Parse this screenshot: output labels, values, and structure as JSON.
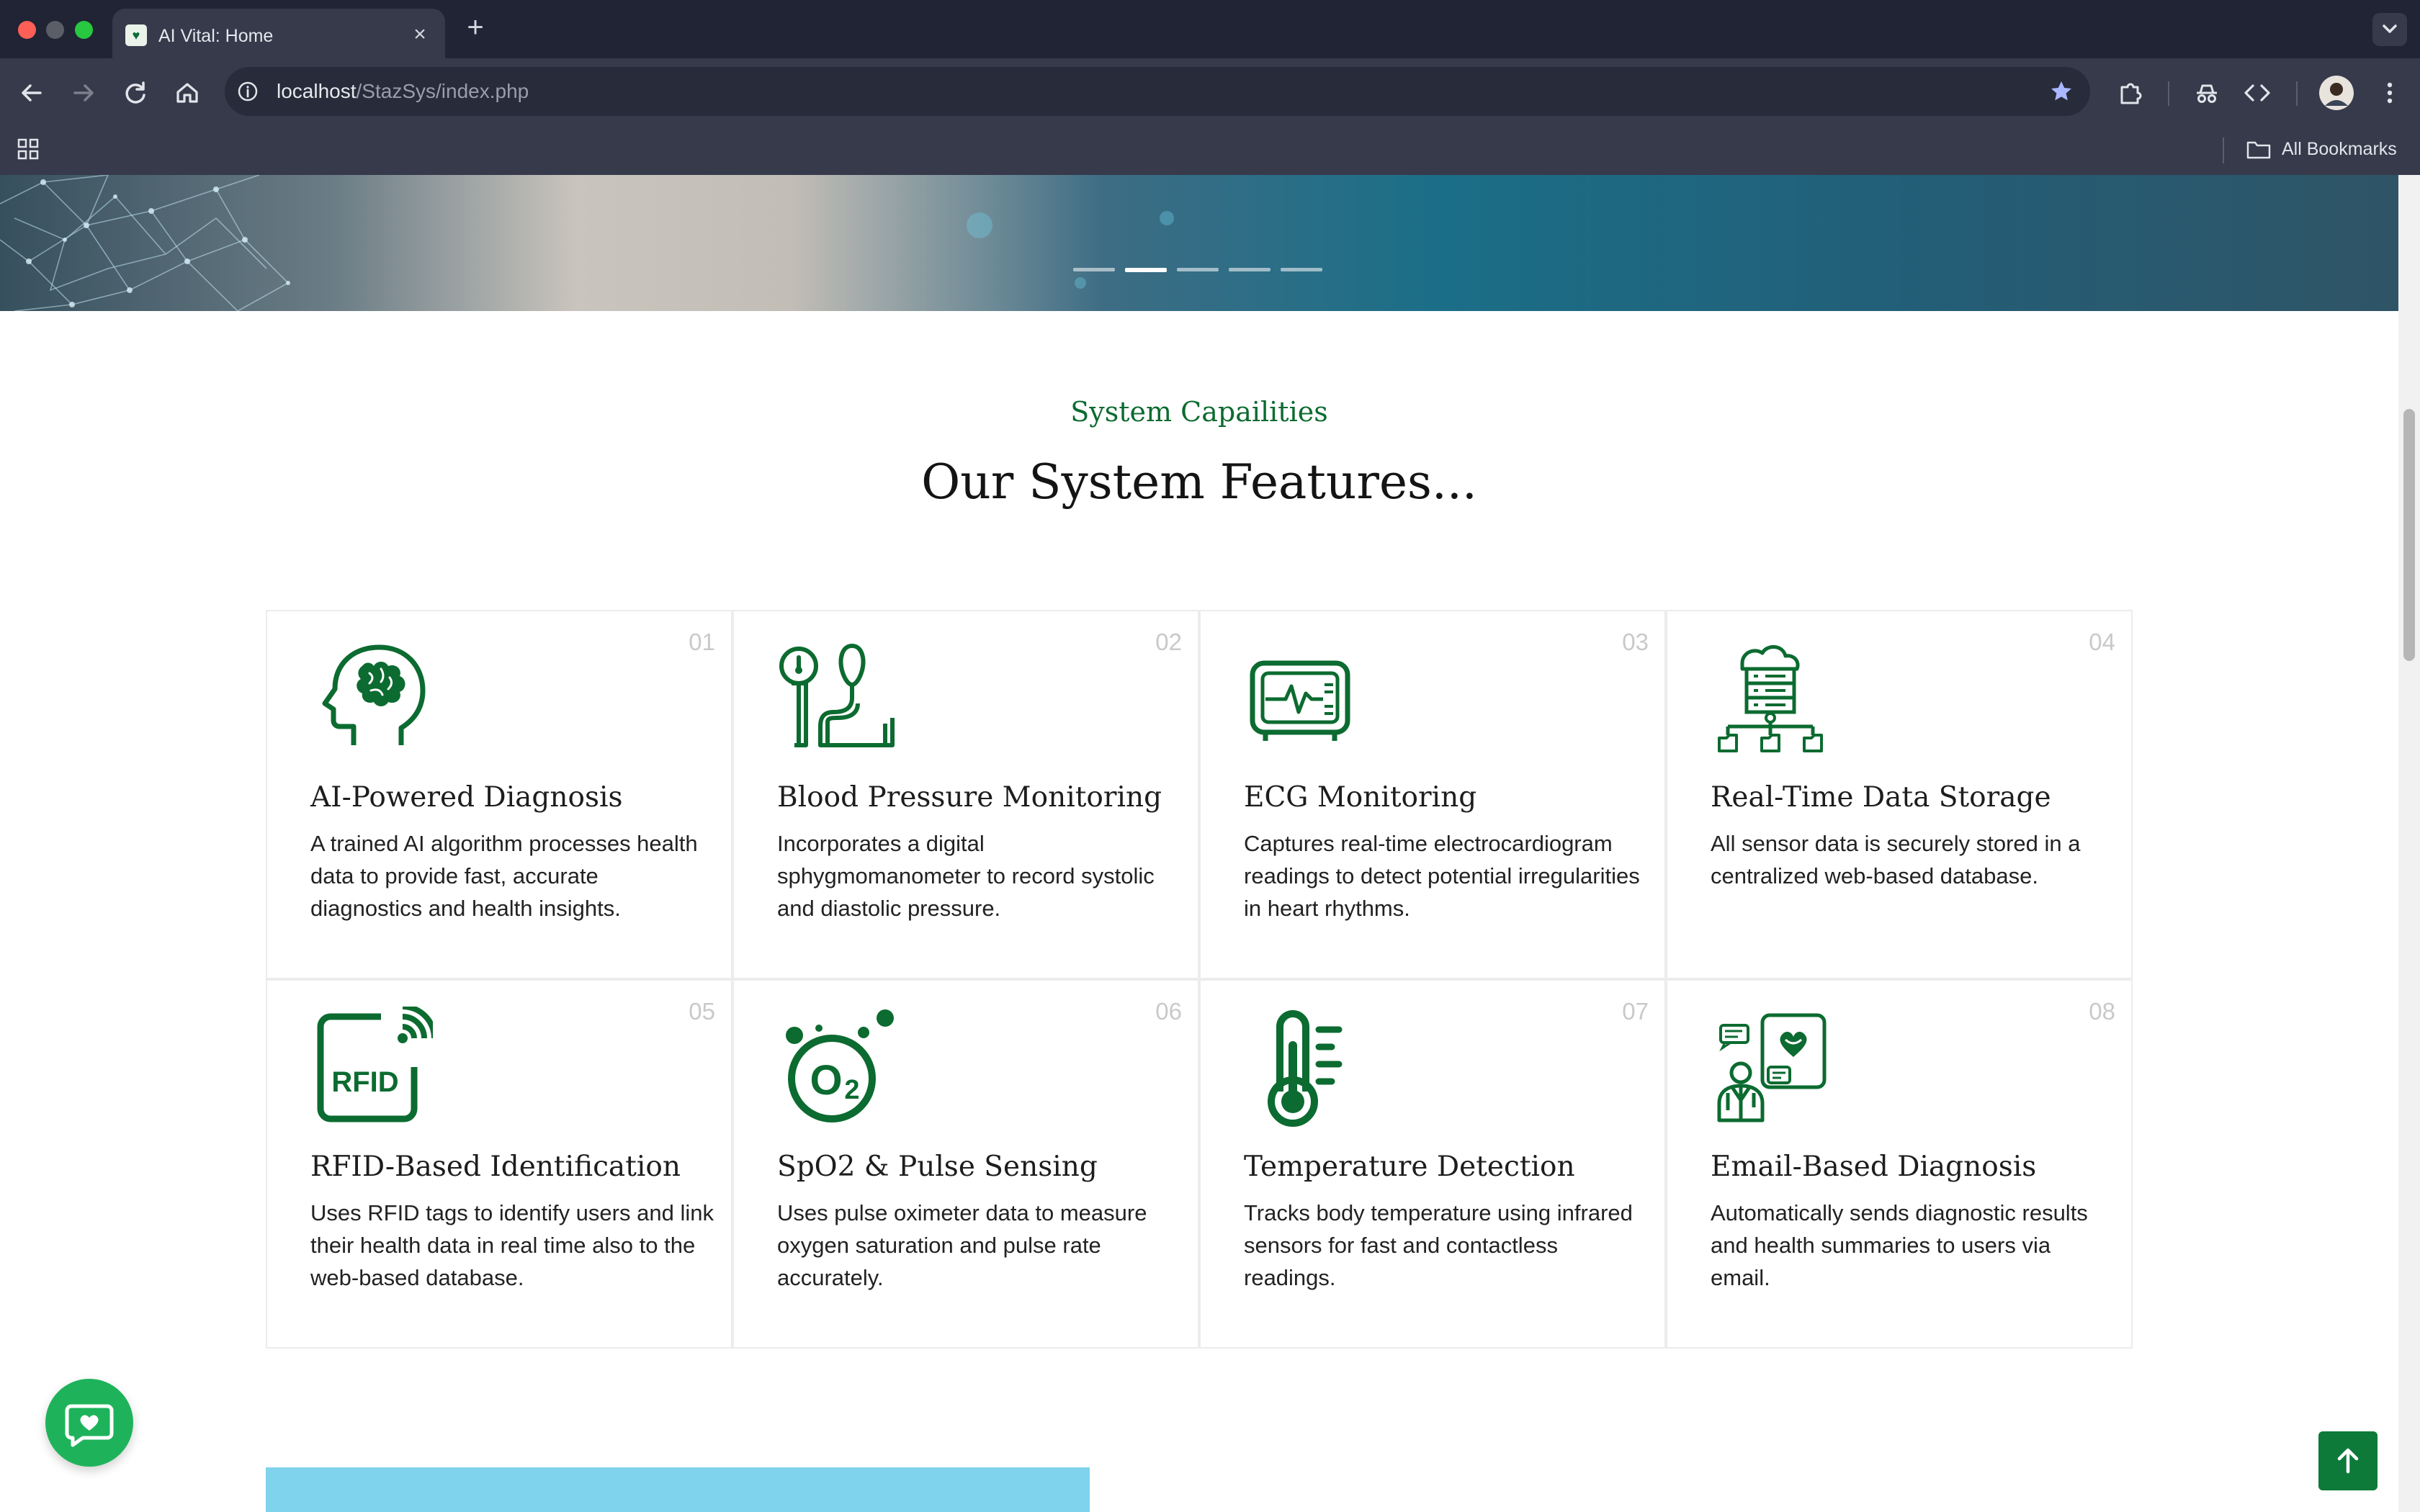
{
  "browser": {
    "tab_title": "AI Vital: Home",
    "url_host": "localhost",
    "url_path": "/StazSys/index.php",
    "bookmarks_label": "All Bookmarks"
  },
  "hero": {
    "slides_count": 5,
    "active_slide": 2
  },
  "features": {
    "eyebrow": "System Capailities",
    "heading": "Our System Features...",
    "items": [
      {
        "num": "01",
        "icon": "brain-head-icon",
        "title": "AI-Powered Diagnosis",
        "desc": "A trained AI algorithm processes health data to provide fast, accurate diagnostics and health insights."
      },
      {
        "num": "02",
        "icon": "blood-pressure-icon",
        "title": "Blood Pressure Monitoring",
        "desc": "Incorporates a digital sphygmomanometer to record systolic and diastolic pressure."
      },
      {
        "num": "03",
        "icon": "ecg-monitor-icon",
        "title": "ECG Monitoring",
        "desc": "Captures real-time electrocardiogram readings to detect potential irregularities in heart rhythms."
      },
      {
        "num": "04",
        "icon": "cloud-database-icon",
        "title": "Real-Time Data Storage",
        "desc": "All sensor data is securely stored in a centralized web-based database."
      },
      {
        "num": "05",
        "icon": "rfid-icon",
        "title": "RFID-Based Identification",
        "desc": "Uses RFID tags to identify users and link their health data in real time also to the web-based database."
      },
      {
        "num": "06",
        "icon": "oxygen-o2-icon",
        "title": "SpO2 & Pulse Sensing",
        "desc": "Uses pulse oximeter data to measure oxygen saturation and pulse rate accurately."
      },
      {
        "num": "07",
        "icon": "thermometer-icon",
        "title": "Temperature Detection",
        "desc": "Tracks body temperature using infrared sensors for fast and contactless readings."
      },
      {
        "num": "08",
        "icon": "doctor-chat-icon",
        "title": "Email-Based Diagnosis",
        "desc": "Automatically sends diagnostic results and health summaries to users via email."
      }
    ]
  },
  "colors": {
    "accent_green": "#0c6b30",
    "chat_button": "#1eb35a",
    "to_top_button": "#0d7a3a",
    "next_section_block": "#7fd3ec"
  },
  "icon_glyphs": {
    "rfid_text": "RFID",
    "o2_text": "O",
    "o2_sub": "2"
  }
}
